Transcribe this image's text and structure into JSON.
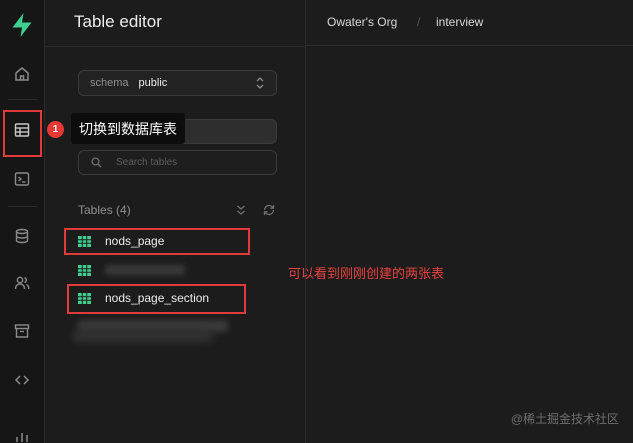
{
  "app": {
    "panel_title": "Table editor"
  },
  "topbar": {
    "org": "Owater's Org",
    "separator": "/",
    "project": "interview"
  },
  "schema_selector": {
    "label": "schema",
    "value": "public"
  },
  "search": {
    "placeholder": "Search tables"
  },
  "tables": {
    "header": "Tables (4)",
    "items": [
      {
        "name": "nods_page"
      },
      {
        "name": ""
      },
      {
        "name": "nods_page_section"
      },
      {
        "name": ""
      }
    ]
  },
  "annotations": {
    "step_number": "1",
    "step_text": "切换到数据库表",
    "note": "可以看到刚刚创建的两张表",
    "highlight_color": "#e03b3b"
  },
  "icons": {
    "rail": [
      "supabase-logo-icon",
      "home-icon",
      "table-editor-icon",
      "sql-editor-icon",
      "database-icon",
      "users-icon",
      "storage-icon",
      "api-icon",
      "reports-icon"
    ]
  },
  "colors": {
    "accent_green": "#3ecf8e",
    "background": "#1c1c1c"
  },
  "watermark": "@稀土掘金技术社区"
}
